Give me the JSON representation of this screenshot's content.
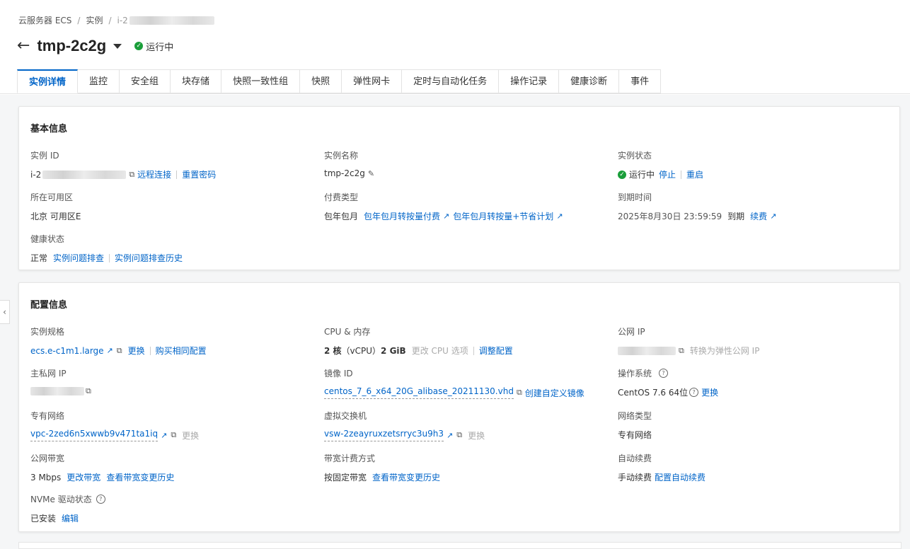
{
  "breadcrumb": {
    "root": "云服务器 ECS",
    "instances": "实例",
    "current": "i-2"
  },
  "title": {
    "name": "tmp-2c2g",
    "status": "运行中"
  },
  "tabs": [
    "实例详情",
    "监控",
    "安全组",
    "块存储",
    "快照一致性组",
    "快照",
    "弹性网卡",
    "定时与自动化任务",
    "操作记录",
    "健康诊断",
    "事件"
  ],
  "basic": {
    "heading": "基本信息",
    "instance_id": {
      "label": "实例 ID",
      "prefix": "i-2",
      "remote": "远程连接",
      "reset": "重置密码"
    },
    "instance_name": {
      "label": "实例名称",
      "value": "tmp-2c2g"
    },
    "instance_status": {
      "label": "实例状态",
      "value": "运行中",
      "stop": "停止",
      "restart": "重启"
    },
    "zone": {
      "label": "所在可用区",
      "value": "北京 可用区E"
    },
    "billing": {
      "label": "付费类型",
      "value": "包年包月",
      "link1": "包年包月转按量付费",
      "link2": "包年包月转按量+节省计划"
    },
    "expire": {
      "label": "到期时间",
      "value": "2025年8月30日 23:59:59",
      "suffix": "到期",
      "renew": "续费"
    },
    "health": {
      "label": "健康状态",
      "value": "正常",
      "link1": "实例问题排查",
      "link2": "实例问题排查历史"
    }
  },
  "config": {
    "heading": "配置信息",
    "spec": {
      "label": "实例规格",
      "value": "ecs.e-c1m1.large",
      "change": "更换",
      "buy": "购买相同配置"
    },
    "cpu": {
      "label": "CPU & 内存",
      "cores": "2 核",
      "vcpu": "（vCPU）",
      "mem": "2 GiB",
      "change_cpu": "更改 CPU 选项",
      "adjust": "调整配置"
    },
    "public_ip": {
      "label": "公网 IP",
      "convert": "转换为弹性公网 IP"
    },
    "private_ip": {
      "label": "主私网 IP"
    },
    "image": {
      "label": "镜像 ID",
      "value": "centos_7_6_x64_20G_alibase_20211130.vhd",
      "create": "创建自定义镜像"
    },
    "os": {
      "label": "操作系统",
      "value": "CentOS 7.6 64位",
      "change": "更换"
    },
    "vpc": {
      "label": "专有网络",
      "value": "vpc-2zed6n5xwwb9v471ta1iq",
      "change": "更换"
    },
    "vswitch": {
      "label": "虚拟交换机",
      "value": "vsw-2zeayruxzetsrryc3u9h3",
      "change": "更换"
    },
    "net_type": {
      "label": "网络类型",
      "value": "专有网络"
    },
    "bandwidth": {
      "label": "公网带宽",
      "value": "3 Mbps",
      "change": "更改带宽",
      "history": "查看带宽变更历史"
    },
    "bw_billing": {
      "label": "带宽计费方式",
      "value": "按固定带宽",
      "history": "查看带宽变更历史"
    },
    "auto_renew": {
      "label": "自动续费",
      "value": "手动续费",
      "config": "配置自动续费"
    },
    "nvme": {
      "label": "NVMe 驱动状态",
      "value": "已安装",
      "edit": "编辑"
    }
  }
}
